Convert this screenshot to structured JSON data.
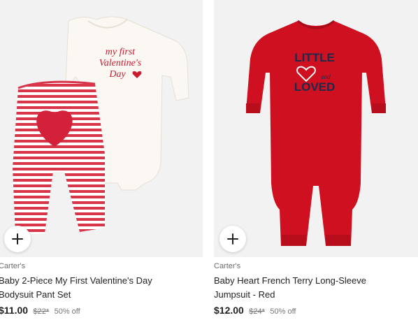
{
  "products": [
    {
      "brand": "Carter's",
      "title_line1": "Baby 2-Piece My First Valentine's Day",
      "title_line2": "Bodysuit Pant Set",
      "price": "$11.00",
      "original_price": "$22*",
      "discount": "50% off",
      "image_text": [
        "my first",
        "Valentine's",
        "Day"
      ],
      "add_icon": "plus-icon"
    },
    {
      "brand": "Carter's",
      "title_line1": "Baby Heart French Terry Long-Sleeve",
      "title_line2": "Jumpsuit - Red",
      "price": "$12.00",
      "original_price": "$24*",
      "discount": "50% off",
      "image_text": [
        "LITTLE",
        "and",
        "LOVED"
      ],
      "add_icon": "plus-icon"
    }
  ],
  "colors": {
    "card_bg": "#f2f2f2",
    "valentine_red": "#d4213a",
    "jumpsuit_red": "#cf1020",
    "navy_print": "#1f2a4a"
  }
}
